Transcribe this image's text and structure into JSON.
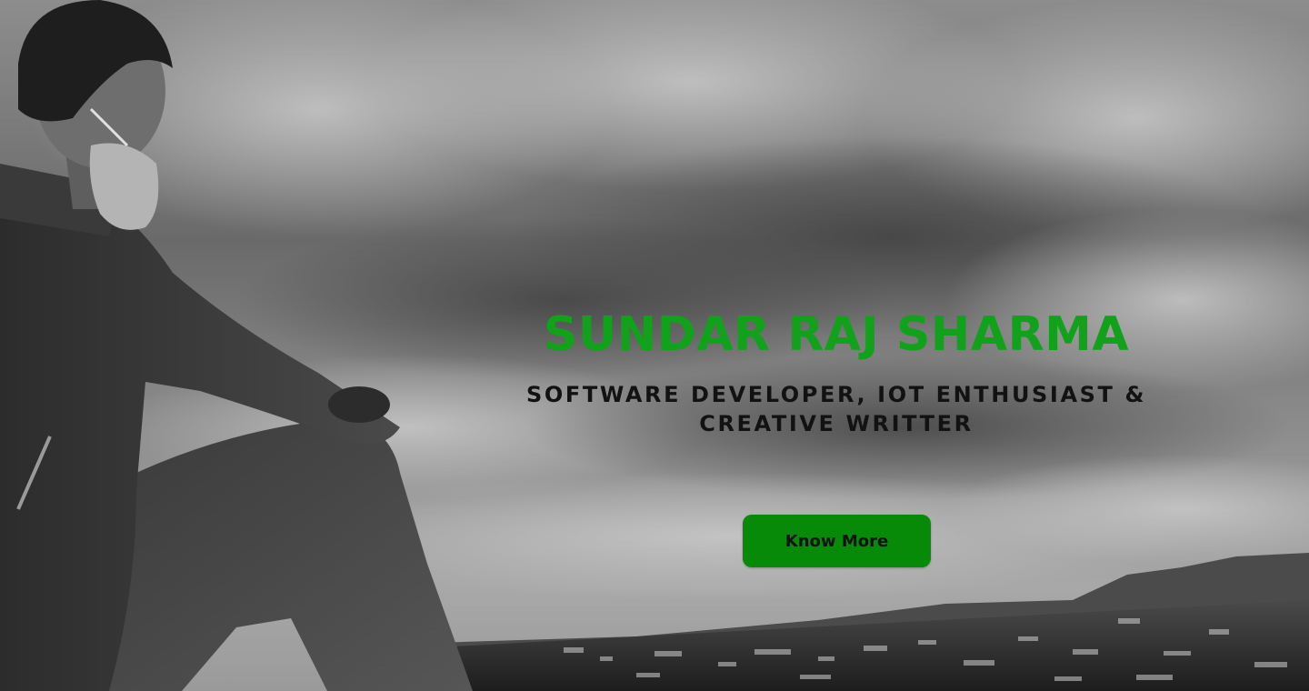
{
  "hero": {
    "name": "SUNDAR RAJ SHARMA",
    "tagline": "SOFTWARE DEVELOPER, IOT ENTHUSIAST & CREATIVE WRITTER",
    "cta_label": "Know More"
  },
  "colors": {
    "accent_green": "#11a11b",
    "button_green": "#078a07",
    "text_dark": "#121212",
    "sky_light": "#bdbdbd",
    "sky_dark": "#5a5a5a"
  },
  "background": {
    "description_icon": "photo-background-icon"
  }
}
